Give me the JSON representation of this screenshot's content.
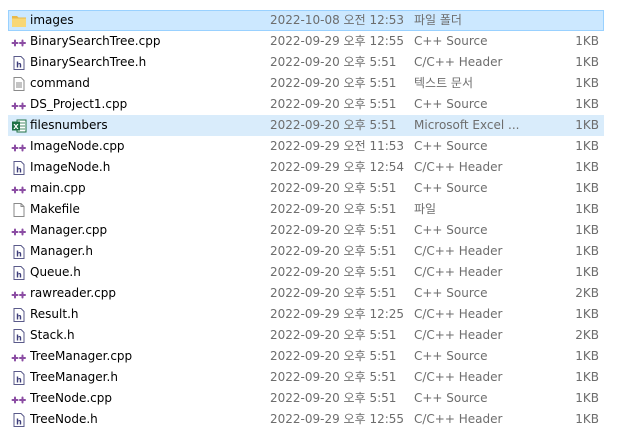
{
  "files": [
    {
      "name": "images",
      "date": "2022-10-08 오전 12:53",
      "type": "파일 폴더",
      "size": "",
      "icon": "folder-icon",
      "state": "selected"
    },
    {
      "name": "BinarySearchTree.cpp",
      "date": "2022-09-29 오후 12:55",
      "type": "C++ Source",
      "size": "1KB",
      "icon": "cpp-source-icon",
      "state": ""
    },
    {
      "name": "BinarySearchTree.h",
      "date": "2022-09-20 오후 5:51",
      "type": "C/C++ Header",
      "size": "1KB",
      "icon": "c-header-icon",
      "state": ""
    },
    {
      "name": "command",
      "date": "2022-09-20 오후 5:51",
      "type": "텍스트 문서",
      "size": "1KB",
      "icon": "text-file-icon",
      "state": ""
    },
    {
      "name": "DS_Project1.cpp",
      "date": "2022-09-20 오후 5:51",
      "type": "C++ Source",
      "size": "1KB",
      "icon": "cpp-source-icon",
      "state": ""
    },
    {
      "name": "filesnumbers",
      "date": "2022-09-20 오후 5:51",
      "type": "Microsoft Excel ...",
      "size": "1KB",
      "icon": "excel-file-icon",
      "state": "hover"
    },
    {
      "name": "ImageNode.cpp",
      "date": "2022-09-29 오전 11:53",
      "type": "C++ Source",
      "size": "1KB",
      "icon": "cpp-source-icon",
      "state": ""
    },
    {
      "name": "ImageNode.h",
      "date": "2022-09-29 오후 12:54",
      "type": "C/C++ Header",
      "size": "1KB",
      "icon": "c-header-icon",
      "state": ""
    },
    {
      "name": "main.cpp",
      "date": "2022-09-20 오후 5:51",
      "type": "C++ Source",
      "size": "1KB",
      "icon": "cpp-source-icon",
      "state": ""
    },
    {
      "name": "Makefile",
      "date": "2022-09-20 오후 5:51",
      "type": "파일",
      "size": "1KB",
      "icon": "blank-file-icon",
      "state": ""
    },
    {
      "name": "Manager.cpp",
      "date": "2022-09-20 오후 5:51",
      "type": "C++ Source",
      "size": "1KB",
      "icon": "cpp-source-icon",
      "state": ""
    },
    {
      "name": "Manager.h",
      "date": "2022-09-20 오후 5:51",
      "type": "C/C++ Header",
      "size": "1KB",
      "icon": "c-header-icon",
      "state": ""
    },
    {
      "name": "Queue.h",
      "date": "2022-09-20 오후 5:51",
      "type": "C/C++ Header",
      "size": "1KB",
      "icon": "c-header-icon",
      "state": ""
    },
    {
      "name": "rawreader.cpp",
      "date": "2022-09-20 오후 5:51",
      "type": "C++ Source",
      "size": "2KB",
      "icon": "cpp-source-icon",
      "state": ""
    },
    {
      "name": "Result.h",
      "date": "2022-09-29 오후 12:25",
      "type": "C/C++ Header",
      "size": "1KB",
      "icon": "c-header-icon",
      "state": ""
    },
    {
      "name": "Stack.h",
      "date": "2022-09-20 오후 5:51",
      "type": "C/C++ Header",
      "size": "2KB",
      "icon": "c-header-icon",
      "state": ""
    },
    {
      "name": "TreeManager.cpp",
      "date": "2022-09-20 오후 5:51",
      "type": "C++ Source",
      "size": "1KB",
      "icon": "cpp-source-icon",
      "state": ""
    },
    {
      "name": "TreeManager.h",
      "date": "2022-09-20 오후 5:51",
      "type": "C/C++ Header",
      "size": "1KB",
      "icon": "c-header-icon",
      "state": ""
    },
    {
      "name": "TreeNode.cpp",
      "date": "2022-09-20 오후 5:51",
      "type": "C++ Source",
      "size": "1KB",
      "icon": "cpp-source-icon",
      "state": ""
    },
    {
      "name": "TreeNode.h",
      "date": "2022-09-29 오후 12:55",
      "type": "C/C++ Header",
      "size": "1KB",
      "icon": "c-header-icon",
      "state": ""
    }
  ],
  "colors": {
    "selected_bg": "#cce8ff",
    "selected_border": "#99d1ff",
    "hover_bg": "#d9ecfb",
    "folder": "#f8d775",
    "cpp_icon": "#8b4ca3",
    "header_icon": "#3d3d7a",
    "excel": "#1e7145"
  }
}
